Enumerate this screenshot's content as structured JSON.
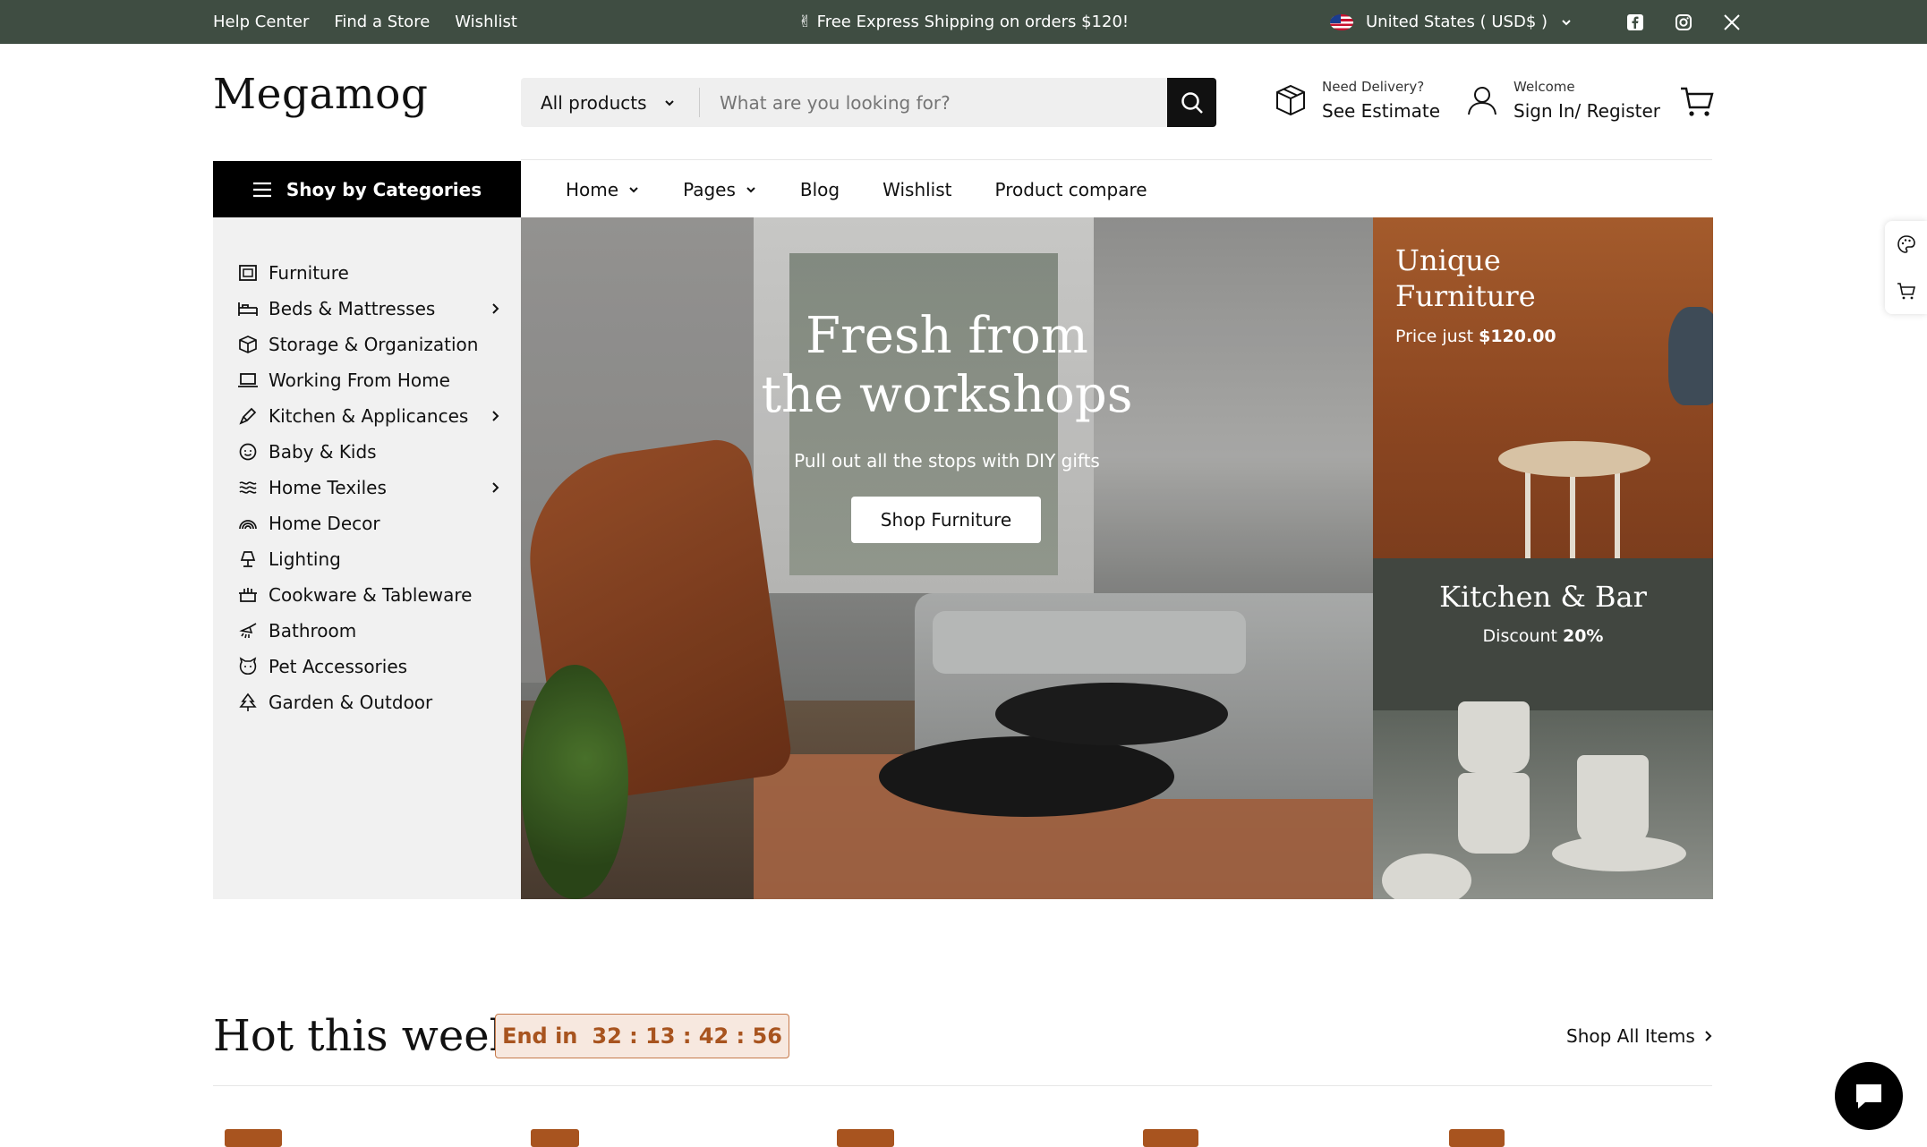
{
  "topbar": {
    "links": [
      "Help Center",
      "Find a Store",
      "Wishlist"
    ],
    "promo": "✌ Free Express Shipping on orders $120!",
    "currency": "United States ( USD$ )"
  },
  "header": {
    "logo": "Megamog",
    "search_category": "All products",
    "search_placeholder": "What are you looking for?",
    "delivery_small": "Need Delivery?",
    "delivery_big": "See Estimate",
    "account_small": "Welcome",
    "account_big": "Sign In/ Register"
  },
  "nav": {
    "categories_button": "Shoy by Categories",
    "items": [
      "Home",
      "Pages",
      "Blog",
      "Wishlist",
      "Product compare"
    ]
  },
  "sidebar": {
    "items": [
      {
        "label": "Furniture",
        "icon": "frame-icon"
      },
      {
        "label": "Beds & Mattresses",
        "icon": "bed-icon"
      },
      {
        "label": "Storage & Organization",
        "icon": "box-icon"
      },
      {
        "label": "Working From Home",
        "icon": "laptop-icon"
      },
      {
        "label": "Kitchen & Applicances",
        "icon": "brush-icon"
      },
      {
        "label": "Baby & Kids",
        "icon": "baby-icon"
      },
      {
        "label": "Home Texiles",
        "icon": "waves-icon"
      },
      {
        "label": "Home Decor",
        "icon": "rainbow-icon"
      },
      {
        "label": "Lighting",
        "icon": "lamp-icon"
      },
      {
        "label": "Cookware & Tableware",
        "icon": "pot-icon"
      },
      {
        "label": "Bathroom",
        "icon": "shower-icon"
      },
      {
        "label": "Pet Accessories",
        "icon": "pet-icon"
      },
      {
        "label": "Garden & Outdoor",
        "icon": "tree-icon"
      }
    ]
  },
  "hero": {
    "title_line1": "Fresh from",
    "title_line2": "the workshops",
    "subtitle": "Pull out all the stops with DIY gifts",
    "button": "Shop Furniture"
  },
  "promo1": {
    "title_line1": "Unique",
    "title_line2": "Furniture",
    "price_prefix": "Price just ",
    "price": "$120.00"
  },
  "promo2": {
    "title": "Kitchen & Bar",
    "discount_prefix": "Discount ",
    "discount": "20%"
  },
  "hot": {
    "title": "Hot this week",
    "timer_label": "End in",
    "timer_value": "32 : 13 : 42 : 56",
    "shop_all": "Shop All Items"
  },
  "colors": {
    "topbar": "#3f4d42",
    "accent": "#a8541f"
  }
}
